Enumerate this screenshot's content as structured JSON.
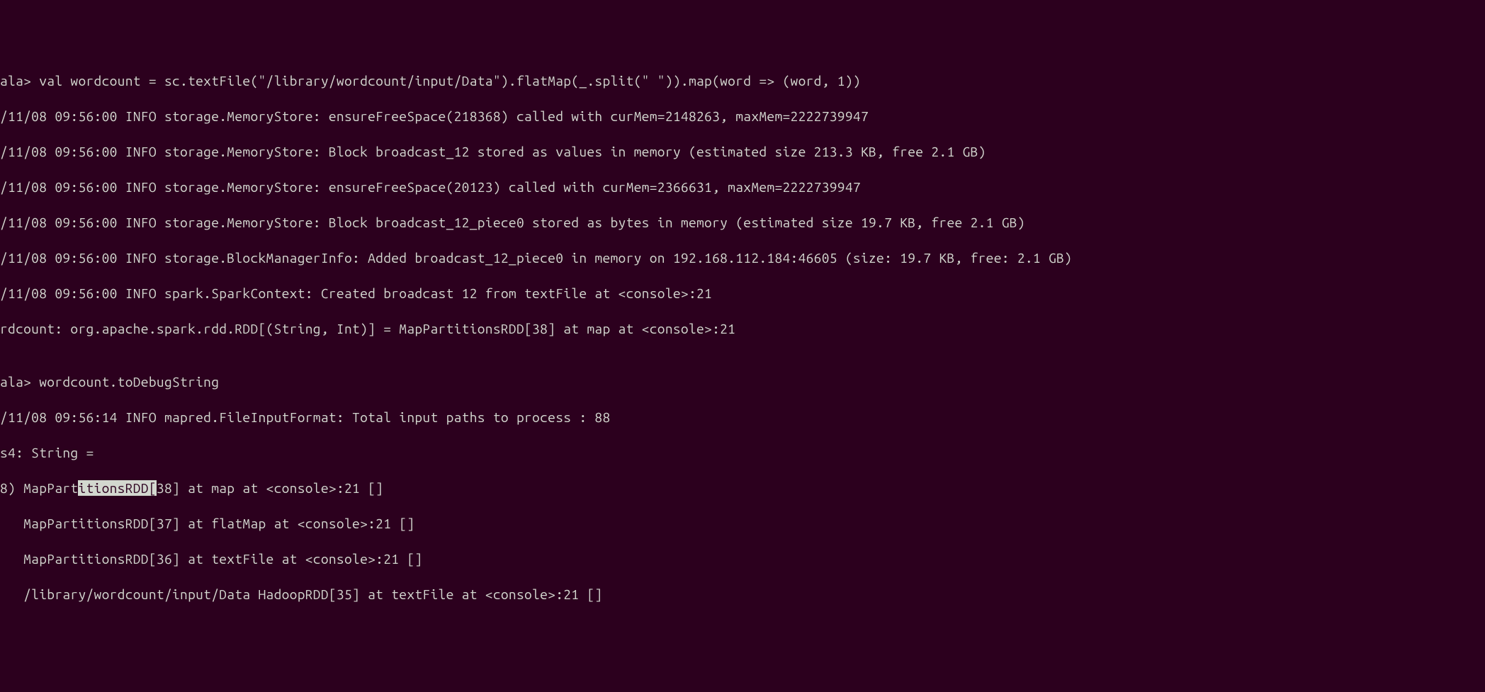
{
  "lines": {
    "l01": "ala> val wordcount = sc.textFile(\"/library/wordcount/input/Data\").flatMap(_.split(\" \")).map(word => (word, 1))",
    "l02": "/11/08 09:56:00 INFO storage.MemoryStore: ensureFreeSpace(218368) called with curMem=2148263, maxMem=2222739947",
    "l03": "/11/08 09:56:00 INFO storage.MemoryStore: Block broadcast_12 stored as values in memory (estimated size 213.3 KB, free 2.1 GB)",
    "l04": "/11/08 09:56:00 INFO storage.MemoryStore: ensureFreeSpace(20123) called with curMem=2366631, maxMem=2222739947",
    "l05": "/11/08 09:56:00 INFO storage.MemoryStore: Block broadcast_12_piece0 stored as bytes in memory (estimated size 19.7 KB, free 2.1 GB)",
    "l06": "/11/08 09:56:00 INFO storage.BlockManagerInfo: Added broadcast_12_piece0 in memory on 192.168.112.184:46605 (size: 19.7 KB, free: 2.1 GB)",
    "l07": "/11/08 09:56:00 INFO spark.SparkContext: Created broadcast 12 from textFile at <console>:21",
    "l08": "rdcount: org.apache.spark.rdd.RDD[(String, Int)] = MapPartitionsRDD[38] at map at <console>:21",
    "l09": "",
    "l10": "ala> wordcount.toDebugString",
    "l11": "/11/08 09:56:14 INFO mapred.FileInputFormat: Total input paths to process : 88",
    "l12": "s4: String =",
    "l13a": "8) MapPart",
    "l13b": "itionsRDD[",
    "l13c": "38] at map at <console>:21 []",
    "l14": "   MapPartitionsRDD[37] at flatMap at <console>:21 []",
    "l15": "   MapPartitionsRDD[36] at textFile at <console>:21 []",
    "l16": "   /library/wordcount/input/Data HadoopRDD[35] at textFile at <console>:21 []"
  }
}
